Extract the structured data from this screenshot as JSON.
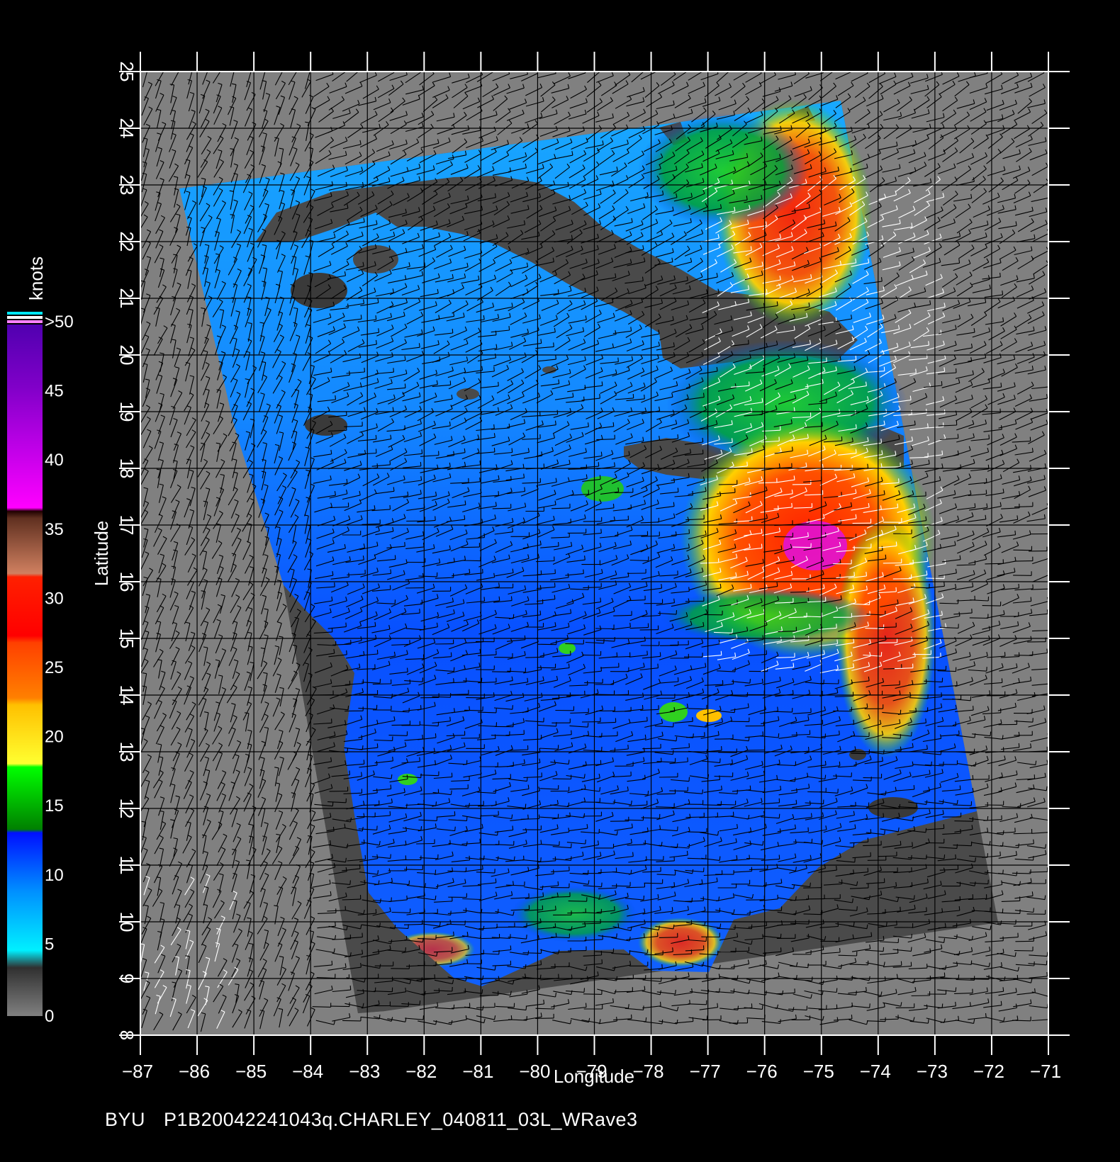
{
  "map": {
    "xaxis": {
      "label": "Longitude",
      "range": [
        -87,
        -71
      ],
      "ticks": [
        "−87",
        "−86",
        "−85",
        "−84",
        "−83",
        "−82",
        "−81",
        "−80",
        "−79",
        "−78",
        "−77",
        "−76",
        "−75",
        "−74",
        "−73",
        "−72",
        "−71"
      ]
    },
    "yaxis": {
      "label": "Latitude",
      "range": [
        8,
        25
      ],
      "ticks": [
        "8",
        "9",
        "10",
        "11",
        "12",
        "13",
        "14",
        "15",
        "16",
        "17",
        "18",
        "19",
        "20",
        "21",
        "22",
        "23",
        "24",
        "25"
      ]
    },
    "background_color": "#000000",
    "nodata_color": "#808080",
    "land_color": "#4a4a4a",
    "grid": true
  },
  "colorbar": {
    "unit": "knots",
    "labels": [
      "0",
      "5",
      "10",
      "15",
      "20",
      "25",
      "30",
      "35",
      "40",
      "45",
      ">50"
    ],
    "colors": [
      "#7a7a7a",
      "#3a3a3a",
      "#00e8ff",
      "#0070ff",
      "#0010ff",
      "#008800",
      "#00ff00",
      "#ffff20",
      "#ffc000",
      "#ff7000",
      "#ff3000",
      "#ff0000",
      "#c07850",
      "#3a1a10",
      "#ff00ff",
      "#b000e0",
      "#7000c0"
    ]
  },
  "footer": {
    "org": "BYU",
    "product": "P1B20042241043q.CHARLEY_040811_03L_WRave3"
  }
}
